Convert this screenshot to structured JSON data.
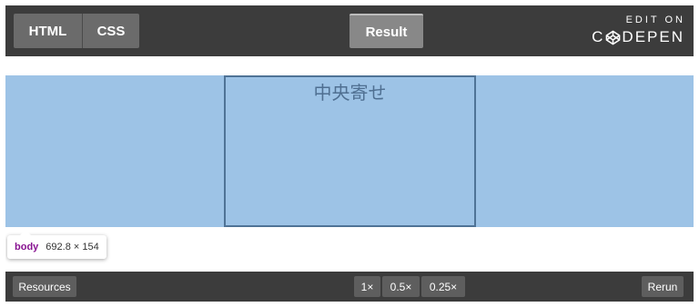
{
  "topbar": {
    "tabs": [
      {
        "label": "HTML"
      },
      {
        "label": "CSS"
      }
    ],
    "result_label": "Result",
    "codepen": {
      "edit_on": "EDIT ON",
      "brand_prefix": "C",
      "brand_suffix": "DEPEN",
      "logo_icon": "codepen-logo-icon"
    }
  },
  "result": {
    "center_text": "中央寄せ",
    "highlight_color": "#9dc3e6",
    "box_border_color": "#4f7396",
    "inspector_tooltip": {
      "tag": "body",
      "dimensions": "692.8 × 154"
    }
  },
  "bottombar": {
    "resources_label": "Resources",
    "zoom_options": [
      "1×",
      "0.5×",
      "0.25×"
    ],
    "rerun_label": "Rerun"
  },
  "colors": {
    "bar_background": "#3c3c3c",
    "tab_background": "#6b6b6b",
    "active_tab_background": "#888888",
    "tag_color": "#881391"
  }
}
